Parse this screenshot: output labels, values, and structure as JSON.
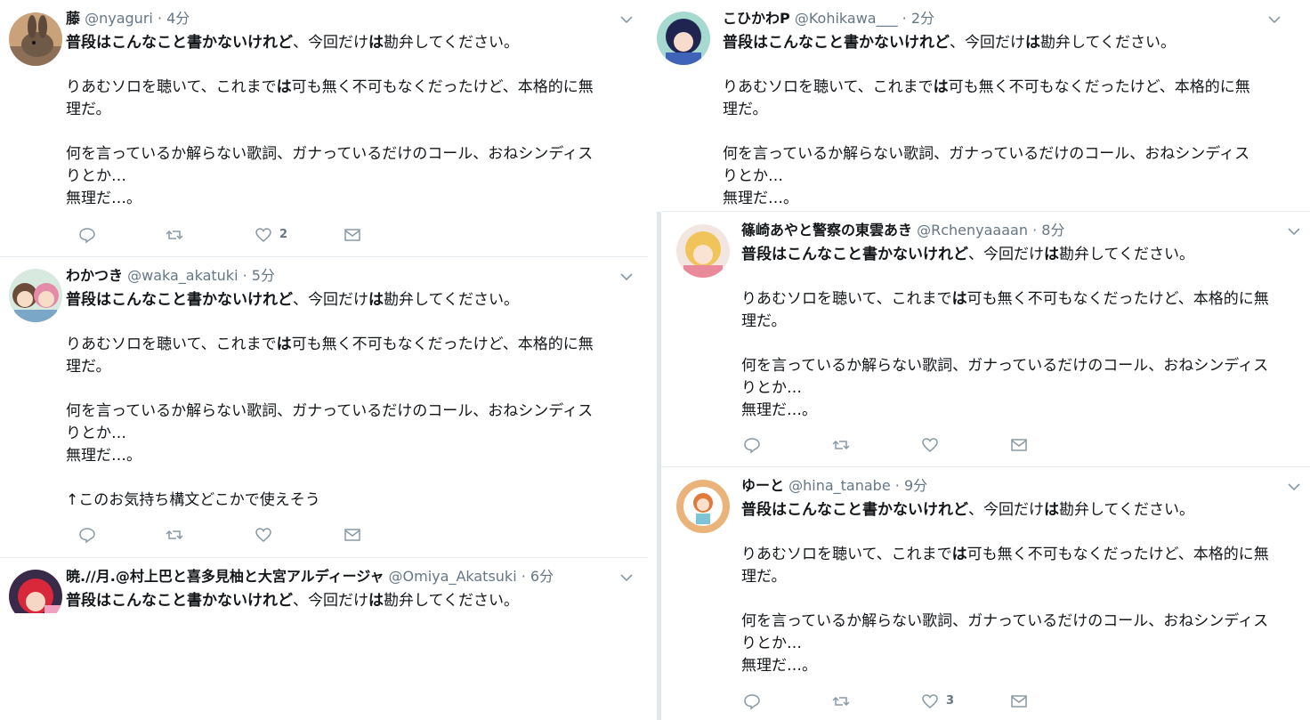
{
  "colors": {
    "muted": "#657786",
    "divider": "#e6ecf0",
    "text": "#14171a"
  },
  "strings": {
    "p1_pre": "普段はこんなこと書かないけれど",
    "p1_post": "、今回だけ",
    "p1_wa": "は",
    "p1_end": "勘弁してください。",
    "p2_pre": "りあむソロを聴いて、これまで",
    "p2_wa": "は",
    "p2_post": "可も無く不可もなくだったけど、本格的に無",
    "p2_l2": "理だ。",
    "p3_l1": "何を言っているか解らない歌詞、ガナっているだけのコール、おねシンディス",
    "p3_l2": "りとか…",
    "p4": "無理だ…。"
  },
  "tweets": [
    {
      "name": "藤",
      "handle": "@nyaguri",
      "dot": "·",
      "time": "4分",
      "reply_count": "",
      "retweet_count": "",
      "like_count": "2",
      "icons": {
        "avatar": "rabbit-avatar"
      }
    },
    {
      "name": "わかつき",
      "handle": "@waka_akatuki",
      "dot": "·",
      "time": "5分",
      "extra": "↑このお気持ち構文どこかで使えそう",
      "like_count": "",
      "icons": {
        "avatar": "anime-girls-avatar"
      }
    },
    {
      "name": "暁.//月.@村上巴と喜多見柚と大宮アルディージャ",
      "handle": "@Omiya_Akatsuki",
      "dot": "·",
      "time": "6分",
      "icons": {
        "avatar": "red-hair-avatar"
      }
    },
    {
      "name": "こひかわP",
      "handle": "@Kohikawa___",
      "dot": "·",
      "time": "2分",
      "icons": {
        "avatar": "dark-hair-avatar"
      }
    },
    {
      "name": "篠崎あやと警察の東雲あき",
      "handle": "@Rchenyaaaan",
      "dot": "·",
      "time": "8分",
      "like_count": "",
      "icons": {
        "avatar": "blonde-avatar"
      }
    },
    {
      "name": "ゆーと",
      "handle": "@hina_tanabe",
      "dot": "·",
      "time": "9分",
      "like_count": "3",
      "icons": {
        "avatar": "chibi-avatar"
      }
    }
  ]
}
